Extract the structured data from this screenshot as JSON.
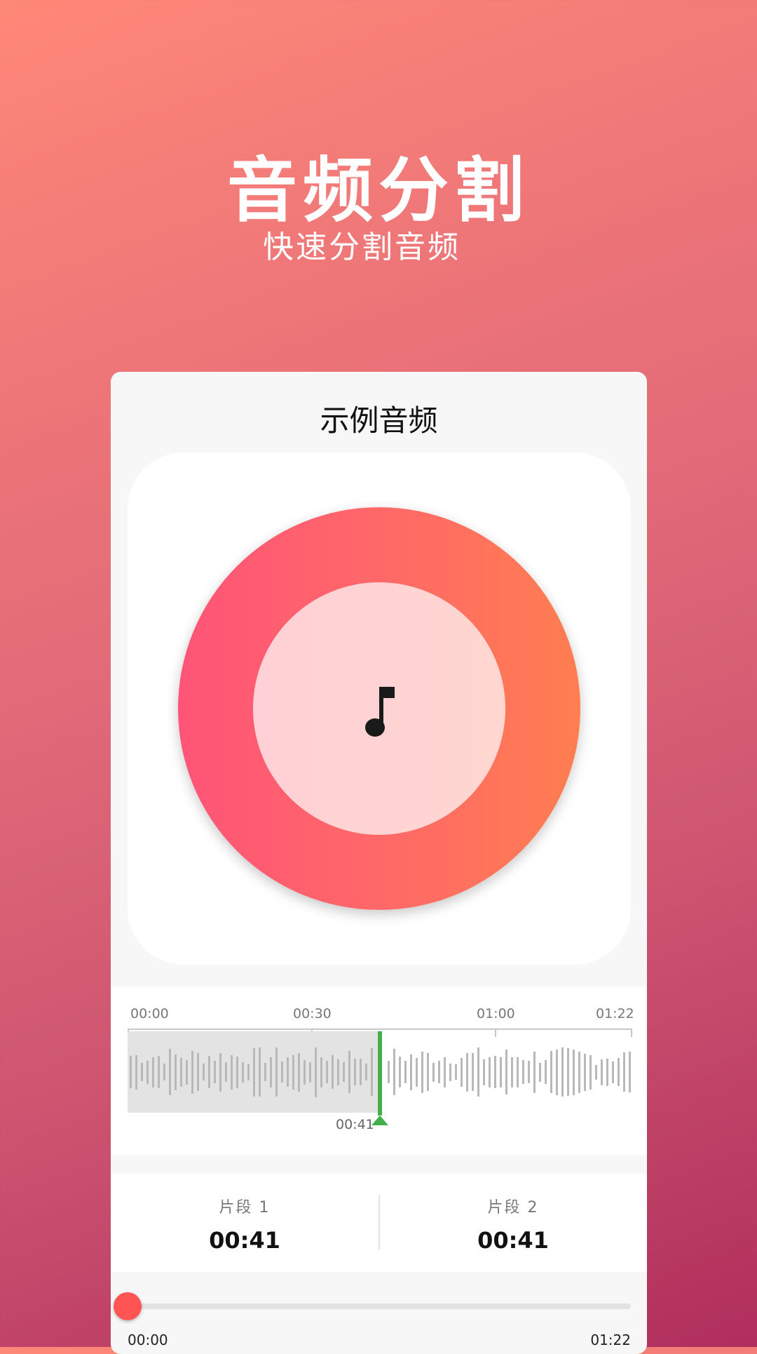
{
  "header": {
    "title": "音频分割",
    "subtitle": "快速分割音频"
  },
  "card": {
    "title": "示例音频",
    "icon": "music-note-icon",
    "accent_colors": {
      "disc_start": "#ff5478",
      "disc_end": "#ff7e50",
      "cursor": "#43b04a",
      "thumb": "#ff5454"
    }
  },
  "timeline": {
    "ticks": [
      "00:00",
      "00:30",
      "01:00",
      "01:22"
    ],
    "cursor_time": "00:41",
    "duration_seconds": 82,
    "cursor_seconds": 41
  },
  "segments": [
    {
      "label": "片段 1",
      "time": "00:41"
    },
    {
      "label": "片段 2",
      "time": "00:41"
    }
  ],
  "playback": {
    "start": "00:00",
    "end": "01:22",
    "progress": 0
  }
}
